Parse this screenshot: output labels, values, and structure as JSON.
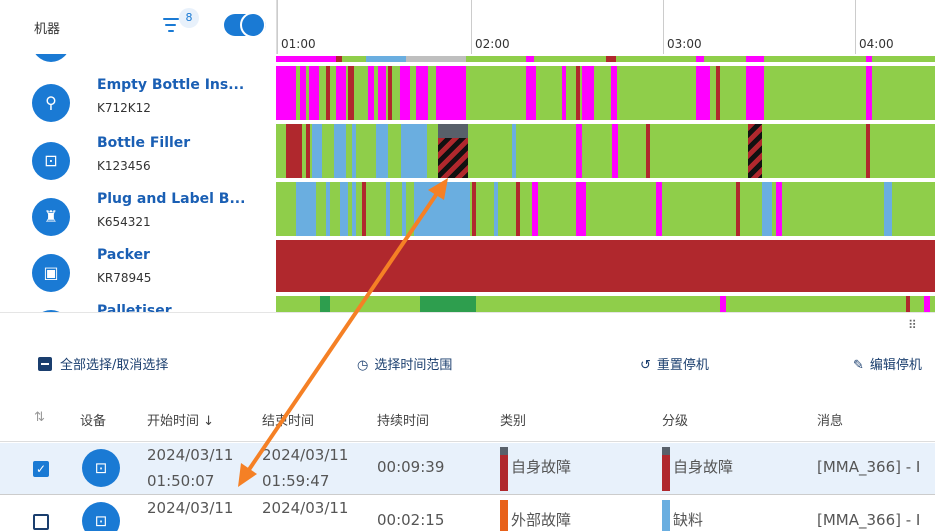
{
  "header": {
    "machines_label": "机器",
    "filter_count": "8"
  },
  "machines": [
    {
      "name": "",
      "code": "",
      "icon": "partial-machine-icon"
    },
    {
      "name": "Empty Bottle Ins...",
      "code": "K712K12",
      "icon": "magnifier-icon"
    },
    {
      "name": "Bottle Filler",
      "code": "K123456",
      "icon": "bottle-fill-icon"
    },
    {
      "name": "Plug and Label B...",
      "code": "K654321",
      "icon": "labeler-icon"
    },
    {
      "name": "Packer",
      "code": "KR78945",
      "icon": "packer-icon"
    },
    {
      "name": "Palletiser",
      "code": "",
      "icon": "palletiser-icon"
    }
  ],
  "timeline": {
    "ticks": [
      "01:00",
      "02:00",
      "03:00",
      "04:00"
    ]
  },
  "toolbar": {
    "select_all": "全部选择/取消选择",
    "select_range": "选择时间范围",
    "reset_stop": "重置停机",
    "edit_stop": "编辑停机"
  },
  "table": {
    "headers": {
      "device": "设备",
      "start": "开始时间",
      "end": "结束时间",
      "duration": "持续时间",
      "category": "类别",
      "level": "分级",
      "message": "消息"
    },
    "rows": [
      {
        "selected": true,
        "start_date": "2024/03/11",
        "start_time": "01:50:07",
        "end_date": "2024/03/11",
        "end_time": "01:59:47",
        "duration": "00:09:39",
        "category": "自身故障",
        "level": "自身故障",
        "message": "[MMA_366] - I"
      },
      {
        "selected": false,
        "start_date": "2024/03/11",
        "start_time": "",
        "end_date": "2024/03/11",
        "end_time": "",
        "duration": "00:02:15",
        "category": "外部故障",
        "level": "缺料",
        "message": "[MMA_366] - I"
      }
    ]
  },
  "colors": {
    "running": "#8fce4a",
    "own_fault": "#b0282d",
    "starved": "#6aaee0",
    "manual_stop": "#ff00ff",
    "planned": "#2e9e4e",
    "accent": "#1a7ad4",
    "arrow": "#f58025"
  }
}
